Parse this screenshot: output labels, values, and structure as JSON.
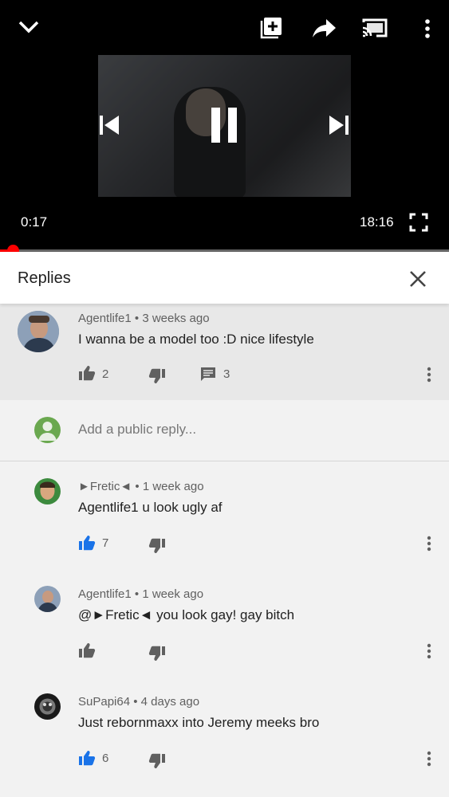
{
  "player": {
    "current_time": "0:17",
    "duration": "18:16",
    "progress": 0.016,
    "icons": [
      "chevron-down-icon",
      "add-to-playlist-icon",
      "share-icon",
      "cast-icon",
      "more-vert-icon",
      "previous-icon",
      "pause-icon",
      "next-icon",
      "fullscreen-icon"
    ]
  },
  "replies_panel": {
    "title": "Replies",
    "close_icon": "close-icon"
  },
  "parent_comment": {
    "author": "Agentlife1",
    "time": "3 weeks ago",
    "text": "I wanna be a model too :D nice lifestyle",
    "likes": "2",
    "reply_count": "3"
  },
  "add_reply": {
    "placeholder": "Add a public reply..."
  },
  "replies": [
    {
      "author": "►Fretic◄",
      "time": "1 week ago",
      "text": "Agentlife1 u look ugly af",
      "likes": "7",
      "liked": true
    },
    {
      "author": "Agentlife1",
      "time": "1 week ago",
      "text": "@►Fretic◄ you look gay! gay bitch",
      "likes": "",
      "liked": false
    },
    {
      "author": "SuPapi64",
      "time": "4 days ago",
      "text": "Just rebornmaxx into Jeremy meeks bro",
      "likes": "6",
      "liked": true
    }
  ],
  "colors": {
    "accent_red": "#ff0000",
    "liked_blue": "#1a73e8",
    "icon_grey": "#606060"
  },
  "meta_separator": "•"
}
